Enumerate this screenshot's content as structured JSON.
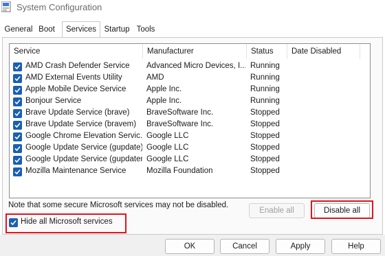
{
  "window": {
    "title": "System Configuration"
  },
  "tabs": [
    {
      "label": "General",
      "active": false
    },
    {
      "label": "Boot",
      "active": false
    },
    {
      "label": "Services",
      "active": true
    },
    {
      "label": "Startup",
      "active": false
    },
    {
      "label": "Tools",
      "active": false
    }
  ],
  "services_table": {
    "columns": [
      "Service",
      "Manufacturer",
      "Status",
      "Date Disabled"
    ],
    "rows": [
      {
        "checked": true,
        "service": "AMD Crash Defender Service",
        "manufacturer": "Advanced Micro Devices, I...",
        "status": "Running",
        "date_disabled": ""
      },
      {
        "checked": true,
        "service": "AMD External Events Utility",
        "manufacturer": "AMD",
        "status": "Running",
        "date_disabled": ""
      },
      {
        "checked": true,
        "service": "Apple Mobile Device Service",
        "manufacturer": "Apple Inc.",
        "status": "Running",
        "date_disabled": ""
      },
      {
        "checked": true,
        "service": "Bonjour Service",
        "manufacturer": "Apple Inc.",
        "status": "Running",
        "date_disabled": ""
      },
      {
        "checked": true,
        "service": "Brave Update Service (brave)",
        "manufacturer": "BraveSoftware Inc.",
        "status": "Stopped",
        "date_disabled": ""
      },
      {
        "checked": true,
        "service": "Brave Update Service (bravem)",
        "manufacturer": "BraveSoftware Inc.",
        "status": "Stopped",
        "date_disabled": ""
      },
      {
        "checked": true,
        "service": "Google Chrome Elevation Servic...",
        "manufacturer": "Google LLC",
        "status": "Stopped",
        "date_disabled": ""
      },
      {
        "checked": true,
        "service": "Google Update Service (gupdate)",
        "manufacturer": "Google LLC",
        "status": "Stopped",
        "date_disabled": ""
      },
      {
        "checked": true,
        "service": "Google Update Service (gupdatem)",
        "manufacturer": "Google LLC",
        "status": "Stopped",
        "date_disabled": ""
      },
      {
        "checked": true,
        "service": "Mozilla Maintenance Service",
        "manufacturer": "Mozilla Foundation",
        "status": "Stopped",
        "date_disabled": ""
      }
    ]
  },
  "note": "Note that some secure Microsoft services may not be disabled.",
  "enable_all": {
    "label": "Enable all",
    "enabled": false
  },
  "disable_all": {
    "label": "Disable all",
    "enabled": true
  },
  "hide_ms": {
    "label": "Hide all Microsoft services",
    "checked": true
  },
  "footer": {
    "ok": "OK",
    "cancel": "Cancel",
    "apply": "Apply",
    "help": "Help"
  },
  "colors": {
    "checkbox": "#1a5fb4",
    "highlight": "#e0141e"
  },
  "icons": {
    "app": "msconfig-app-icon",
    "check": "check-icon"
  }
}
